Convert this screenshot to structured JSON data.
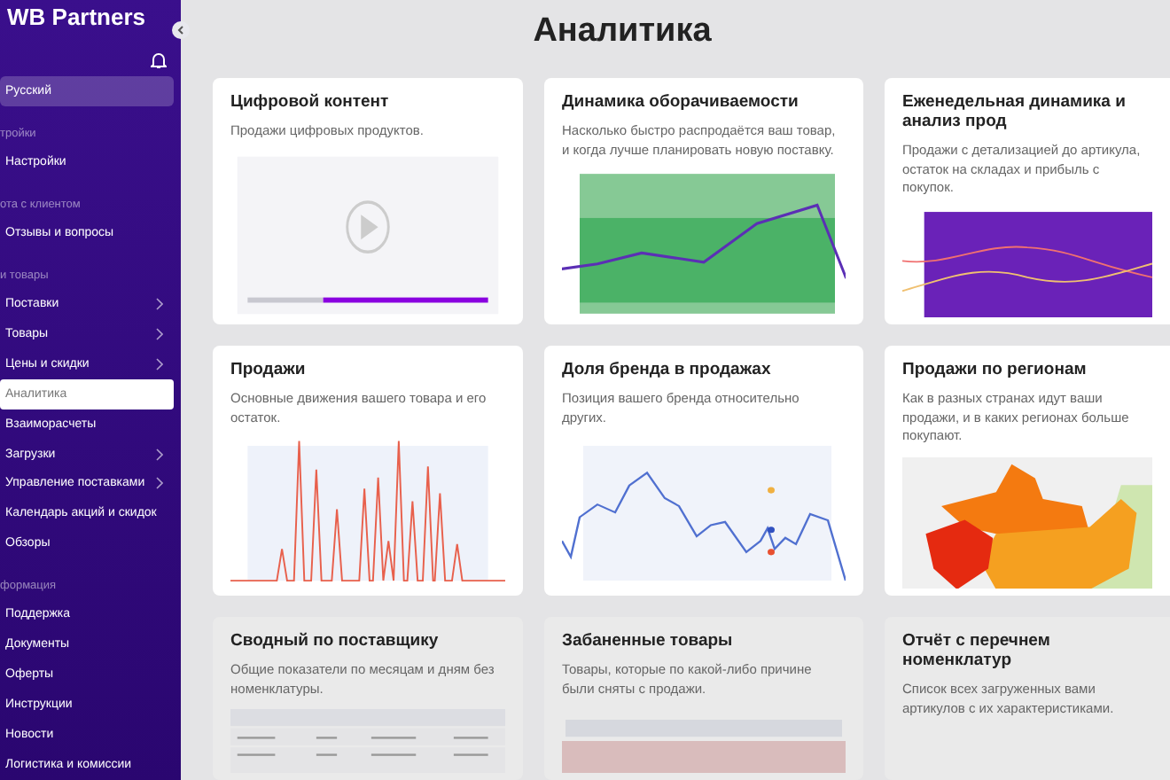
{
  "sidebar": {
    "logo": "WB Partners",
    "language": "Русский",
    "sections": [
      {
        "heading": "тройки",
        "items": [
          {
            "label": "Настройки",
            "selected": false,
            "expandable": false
          }
        ]
      },
      {
        "heading": "ота с клиентом",
        "items": [
          {
            "label": "Отзывы и вопросы",
            "selected": false,
            "expandable": false
          }
        ]
      },
      {
        "heading": "и товары",
        "items": [
          {
            "label": "Поставки",
            "selected": false,
            "expandable": true
          },
          {
            "label": "Товары",
            "selected": false,
            "expandable": true
          },
          {
            "label": "Цены и скидки",
            "selected": false,
            "expandable": true
          },
          {
            "label": "Аналитика",
            "selected": true,
            "expandable": false
          },
          {
            "label": "Взаиморасчеты",
            "selected": false,
            "expandable": false
          },
          {
            "label": "Загрузки",
            "selected": false,
            "expandable": true
          },
          {
            "label": "Управление поставками",
            "selected": false,
            "expandable": true
          },
          {
            "label": "Календарь акций и скидок",
            "selected": false,
            "expandable": false
          },
          {
            "label": "Обзоры",
            "selected": false,
            "expandable": false
          }
        ]
      },
      {
        "heading": "формация",
        "items": [
          {
            "label": "Поддержка",
            "selected": false,
            "expandable": false
          },
          {
            "label": "Документы",
            "selected": false,
            "expandable": false
          },
          {
            "label": "Оферты",
            "selected": false,
            "expandable": false
          },
          {
            "label": "Инструкции",
            "selected": false,
            "expandable": false
          },
          {
            "label": "Новости",
            "selected": false,
            "expandable": false
          },
          {
            "label": "Логистика и комиссии",
            "selected": false,
            "expandable": false
          }
        ]
      }
    ]
  },
  "page_title": "Аналитика",
  "cards": [
    {
      "title": "Цифровой контент",
      "description": "Продажи цифровых продуктов.",
      "kind": "video"
    },
    {
      "title": "Динамика оборачиваемости",
      "description": "Насколько быстро распродаётся ваш товар, и когда лучше планировать новую поставку.",
      "kind": "turnover"
    },
    {
      "title": "Еженедельная динамика и анализ прод",
      "description": "Продажи с детализацией до артикула, остаток на складах и прибыль с покупок.",
      "kind": "weekly"
    },
    {
      "title": "Продажи",
      "description": "Основные движения вашего товара и его остаток.",
      "kind": "sales"
    },
    {
      "title": "Доля бренда в продажах",
      "description": "Позиция вашего бренда относительно других.",
      "kind": "brand"
    },
    {
      "title": "Продажи по регионам",
      "description": "Как в разных странах идут ваши продажи, и в каких регионах больше покупают.",
      "kind": "regions"
    },
    {
      "title": "Сводный по поставщику",
      "description": "Общие показатели по месяцам и дням без номенклатуры.",
      "kind": "table"
    },
    {
      "title": "Забаненные товары",
      "description": "Товары, которые по какой-либо причине были сняты с продажи.",
      "kind": "banned"
    },
    {
      "title": "Отчёт с перечнем номенклатур",
      "description": "Список всех загруженных вами артикулов с их характеристиками.",
      "kind": "text"
    }
  ]
}
